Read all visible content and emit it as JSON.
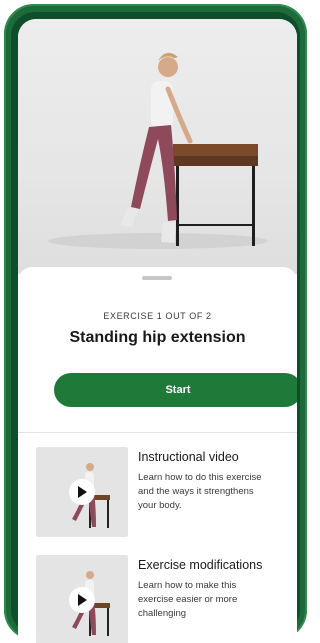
{
  "exercise": {
    "counter": "EXERCISE  1 OUT OF 2",
    "title": "Standing hip extension",
    "start_label": "Start"
  },
  "cards": [
    {
      "title": "Instructional video",
      "description_lines": [
        "Learn how to do this exercise",
        "and the ways it strengthens",
        "your body."
      ]
    },
    {
      "title": "Exercise modifications",
      "description_lines": [
        "Learn how to make this",
        "exercise easier or more",
        "challenging"
      ]
    }
  ],
  "icons": {
    "play": "play-icon",
    "handle": "drag-handle"
  },
  "colors": {
    "brand_green": "#1f7a3a",
    "bezel_green": "#1d6b3b"
  }
}
